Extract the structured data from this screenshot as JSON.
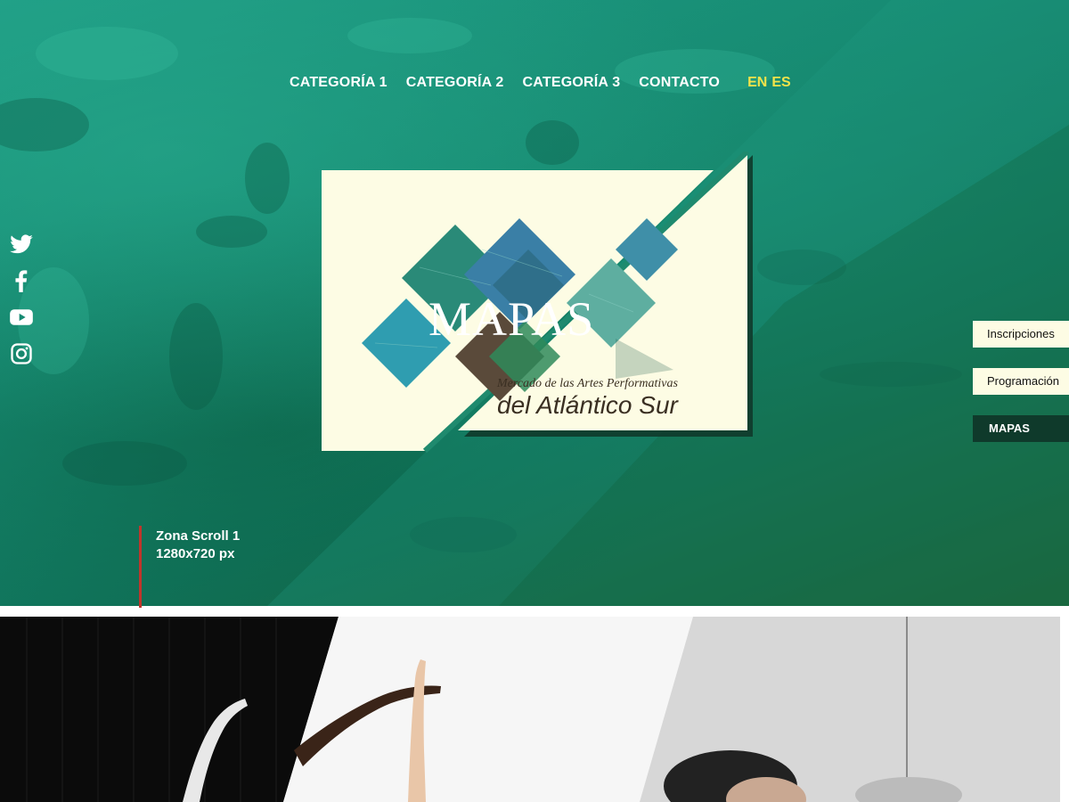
{
  "nav": {
    "items": [
      {
        "label": "CATEGORÍA 1"
      },
      {
        "label": "CATEGORÍA 2"
      },
      {
        "label": "CATEGORÍA 3"
      },
      {
        "label": "CONTACTO"
      }
    ],
    "languages": [
      {
        "label": "EN"
      },
      {
        "label": "ES"
      }
    ]
  },
  "social": {
    "icons": [
      "twitter-icon",
      "facebook-icon",
      "youtube-icon",
      "instagram-icon"
    ]
  },
  "logo": {
    "title": "MAPAS",
    "subtitle": "Mercado de las Artes Performativas",
    "tagline": "del Atlántico Sur"
  },
  "side_tabs": [
    {
      "label": "Inscripciones"
    },
    {
      "label": "Programación"
    },
    {
      "label": "MAPAS"
    }
  ],
  "scroll_zone": {
    "line1": "Zona Scroll 1",
    "line2": "1280x720 px"
  },
  "colors": {
    "accent_yellow": "#f2e34a",
    "hero_teal": "#168a72",
    "card_cream": "#fdfce4",
    "tab_dark": "#0f3a2b",
    "marker_red": "#c0352b"
  }
}
